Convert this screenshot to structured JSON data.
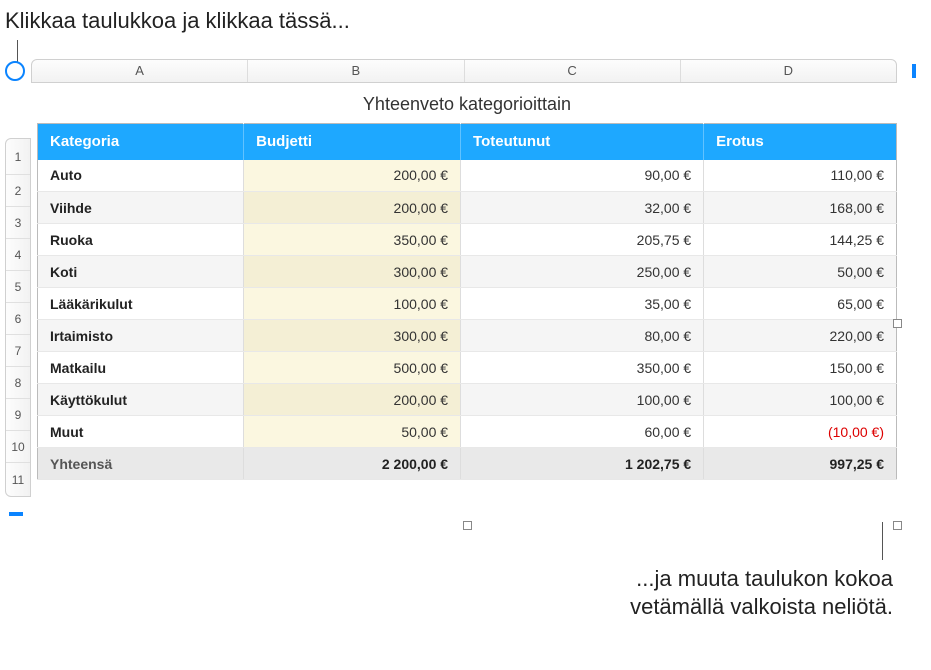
{
  "callouts": {
    "top": "Klikkaa taulukkoa ja klikkaa tässä...",
    "bottom": "...ja muuta taulukon kokoa\nvetämällä valkoista neliötä."
  },
  "columns": [
    "A",
    "B",
    "C",
    "D"
  ],
  "rowNumbers": [
    "1",
    "2",
    "3",
    "4",
    "5",
    "6",
    "7",
    "8",
    "9",
    "10",
    "11"
  ],
  "table": {
    "title": "Yhteenveto kategorioittain",
    "headers": {
      "category": "Kategoria",
      "budget": "Budjetti",
      "actual": "Toteutunut",
      "diff": "Erotus"
    },
    "rows": [
      {
        "category": "Auto",
        "budget": "200,00 €",
        "actual": "90,00 €",
        "diff": "110,00 €",
        "neg": false
      },
      {
        "category": "Viihde",
        "budget": "200,00 €",
        "actual": "32,00 €",
        "diff": "168,00 €",
        "neg": false
      },
      {
        "category": "Ruoka",
        "budget": "350,00 €",
        "actual": "205,75 €",
        "diff": "144,25 €",
        "neg": false
      },
      {
        "category": "Koti",
        "budget": "300,00 €",
        "actual": "250,00 €",
        "diff": "50,00 €",
        "neg": false
      },
      {
        "category": "Lääkärikulut",
        "budget": "100,00 €",
        "actual": "35,00 €",
        "diff": "65,00 €",
        "neg": false
      },
      {
        "category": "Irtaimisto",
        "budget": "300,00 €",
        "actual": "80,00 €",
        "diff": "220,00 €",
        "neg": false
      },
      {
        "category": "Matkailu",
        "budget": "500,00 €",
        "actual": "350,00 €",
        "diff": "150,00 €",
        "neg": false
      },
      {
        "category": "Käyttökulut",
        "budget": "200,00 €",
        "actual": "100,00 €",
        "diff": "100,00 €",
        "neg": false
      },
      {
        "category": "Muut",
        "budget": "50,00 €",
        "actual": "60,00 €",
        "diff": "(10,00 €)",
        "neg": true
      }
    ],
    "total": {
      "label": "Yhteensä",
      "budget": "2 200,00 €",
      "actual": "1 202,75 €",
      "diff": "997,25 €"
    }
  },
  "chart_data": {
    "type": "table",
    "title": "Yhteenveto kategorioittain",
    "columns": [
      "Kategoria",
      "Budjetti",
      "Toteutunut",
      "Erotus"
    ],
    "rows": [
      [
        "Auto",
        200.0,
        90.0,
        110.0
      ],
      [
        "Viihde",
        200.0,
        32.0,
        168.0
      ],
      [
        "Ruoka",
        350.0,
        205.75,
        144.25
      ],
      [
        "Koti",
        300.0,
        250.0,
        50.0
      ],
      [
        "Lääkärikulut",
        100.0,
        35.0,
        65.0
      ],
      [
        "Irtaimisto",
        300.0,
        80.0,
        220.0
      ],
      [
        "Matkailu",
        500.0,
        350.0,
        150.0
      ],
      [
        "Käyttökulut",
        200.0,
        100.0,
        100.0
      ],
      [
        "Muut",
        50.0,
        60.0,
        -10.0
      ]
    ],
    "totals": [
      "Yhteensä",
      2200.0,
      1202.75,
      997.25
    ],
    "currency": "EUR"
  }
}
